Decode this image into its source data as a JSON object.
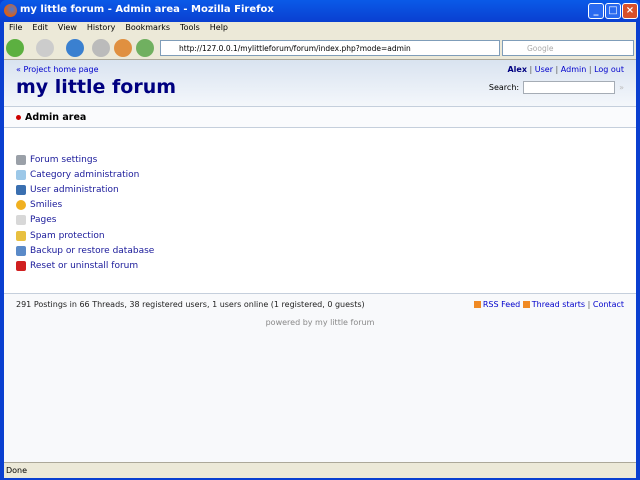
{
  "window": {
    "title": "my little forum - Admin area - Mozilla Firefox"
  },
  "menu": [
    "File",
    "Edit",
    "View",
    "History",
    "Bookmarks",
    "Tools",
    "Help"
  ],
  "toolbar": {
    "url": "http://127.0.0.1/mylittleforum/forum/index.php?mode=admin",
    "search_placeholder": "Google"
  },
  "header": {
    "home_link": "« Project home page",
    "logo": "my little forum",
    "user": "Alex",
    "nav": [
      "User",
      "Admin",
      "Log out"
    ],
    "search_label": "Search:",
    "search_go": "»"
  },
  "subheader": {
    "title": "Admin area"
  },
  "admin_items": [
    {
      "label": "Forum settings",
      "icon": "gear-icon",
      "color": "#9aa0a8"
    },
    {
      "label": "Category administration",
      "icon": "speech-bubbles-icon",
      "color": "#9cc8e8"
    },
    {
      "label": "User administration",
      "icon": "user-icon",
      "color": "#3a6fb0"
    },
    {
      "label": "Smilies",
      "icon": "smiley-icon",
      "color": "#f0b020"
    },
    {
      "label": "Pages",
      "icon": "pages-icon",
      "color": "#d8d8d8"
    },
    {
      "label": "Spam protection",
      "icon": "shield-icon",
      "color": "#e8c040"
    },
    {
      "label": "Backup or restore database",
      "icon": "database-icon",
      "color": "#5a8ac8"
    },
    {
      "label": "Reset or uninstall forum",
      "icon": "red-x-icon",
      "color": "#d02020"
    }
  ],
  "footer": {
    "stats": "291 Postings in 66 Threads, 38 registered users, 1 users online (1 registered, 0 guests)",
    "rss": "RSS Feed",
    "thread_starts": "Thread starts",
    "contact": "Contact",
    "powered": "powered by my little forum"
  },
  "statusbar": {
    "text": "Done"
  }
}
